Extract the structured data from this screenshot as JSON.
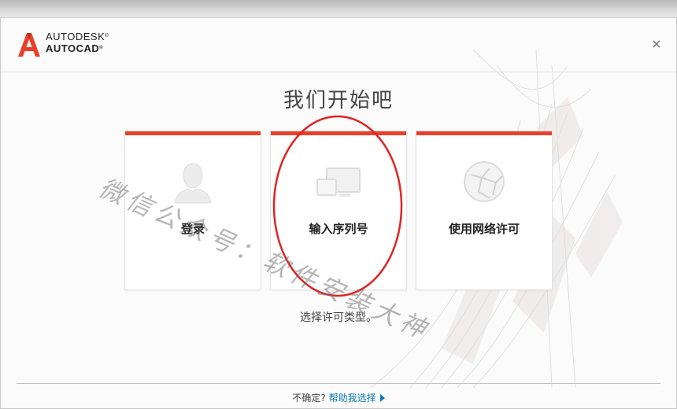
{
  "header": {
    "brand_line1": "AUTODESK",
    "brand_line2": "AUTOCAD",
    "trademark": "®",
    "close_label": "×"
  },
  "main": {
    "title": "我们开始吧",
    "cards": [
      {
        "label": "登录",
        "icon": "user-silhouette-icon"
      },
      {
        "label": "输入序列号",
        "icon": "monitor-devices-icon"
      },
      {
        "label": "使用网络许可",
        "icon": "globe-network-icon"
      }
    ],
    "subtitle": "选择许可类型。"
  },
  "footer": {
    "prompt": "不确定?",
    "help_link": "帮助我选择"
  },
  "overlay": {
    "watermark": "微信公众号：软件安装大神",
    "annotation": "red-circle-around-serial-number-card"
  },
  "colors": {
    "accent": "#e8412b",
    "link": "#0a79b8",
    "annotation": "#e02424",
    "text": "#333333"
  }
}
